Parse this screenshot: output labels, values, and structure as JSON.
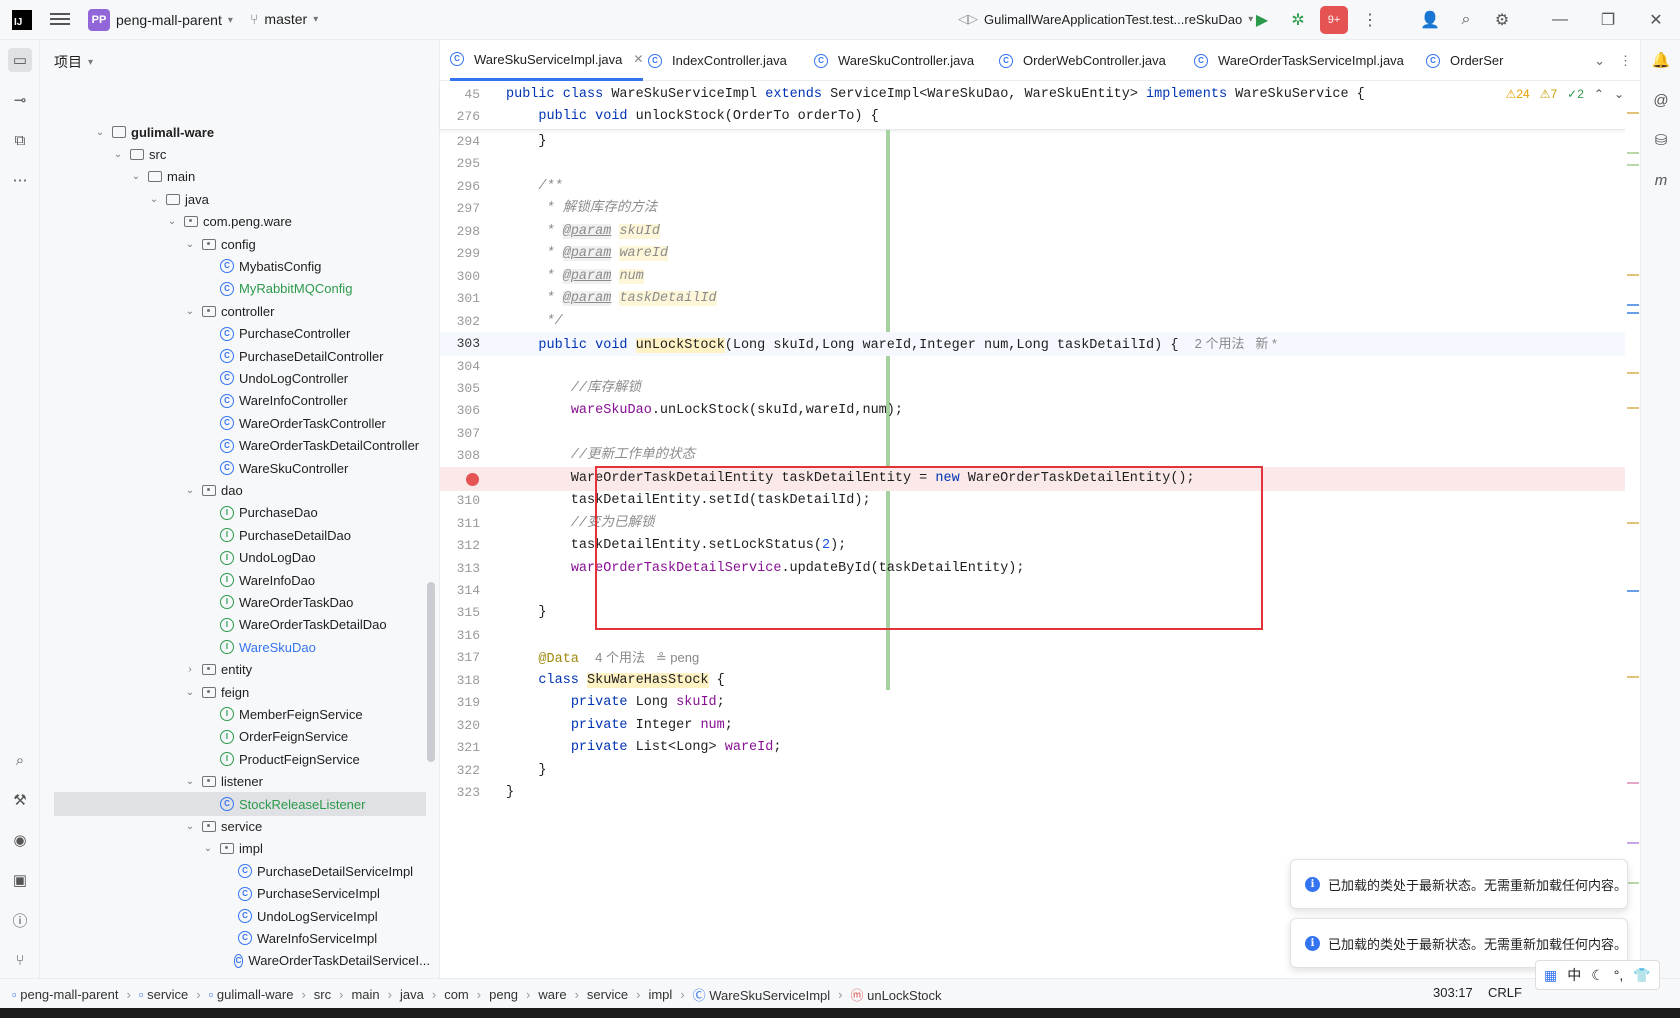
{
  "titlebar": {
    "project_badge": "PP",
    "project_name": "peng-mall-parent",
    "branch": "master",
    "run_config": "GulimallWareApplicationTest.test...reSkuDao",
    "record_badge": "9+"
  },
  "project_panel": {
    "title": "项目",
    "tree": [
      {
        "label": "gulimall-ware",
        "type": "module",
        "depth": 0,
        "arrow": "down",
        "bold": true
      },
      {
        "label": "src",
        "type": "folder",
        "depth": 1,
        "arrow": "down"
      },
      {
        "label": "main",
        "type": "folder",
        "depth": 2,
        "arrow": "down"
      },
      {
        "label": "java",
        "type": "folder",
        "depth": 3,
        "arrow": "down"
      },
      {
        "label": "com.peng.ware",
        "type": "package",
        "depth": 4,
        "arrow": "down"
      },
      {
        "label": "config",
        "type": "package",
        "depth": 5,
        "arrow": "down"
      },
      {
        "label": "MybatisConfig",
        "type": "class",
        "depth": 6
      },
      {
        "label": "MyRabbitMQConfig",
        "type": "class",
        "depth": 6,
        "color": "#2c9a4b"
      },
      {
        "label": "controller",
        "type": "package",
        "depth": 5,
        "arrow": "down"
      },
      {
        "label": "PurchaseController",
        "type": "class",
        "depth": 6
      },
      {
        "label": "PurchaseDetailController",
        "type": "class",
        "depth": 6
      },
      {
        "label": "UndoLogController",
        "type": "class",
        "depth": 6
      },
      {
        "label": "WareInfoController",
        "type": "class",
        "depth": 6
      },
      {
        "label": "WareOrderTaskController",
        "type": "class",
        "depth": 6
      },
      {
        "label": "WareOrderTaskDetailController",
        "type": "class",
        "depth": 6
      },
      {
        "label": "WareSkuController",
        "type": "class",
        "depth": 6
      },
      {
        "label": "dao",
        "type": "package",
        "depth": 5,
        "arrow": "down"
      },
      {
        "label": "PurchaseDao",
        "type": "interface",
        "depth": 6
      },
      {
        "label": "PurchaseDetailDao",
        "type": "interface",
        "depth": 6
      },
      {
        "label": "UndoLogDao",
        "type": "interface",
        "depth": 6
      },
      {
        "label": "WareInfoDao",
        "type": "interface",
        "depth": 6
      },
      {
        "label": "WareOrderTaskDao",
        "type": "interface",
        "depth": 6
      },
      {
        "label": "WareOrderTaskDetailDao",
        "type": "interface",
        "depth": 6
      },
      {
        "label": "WareSkuDao",
        "type": "interface",
        "depth": 6,
        "color": "#3574f0"
      },
      {
        "label": "entity",
        "type": "package",
        "depth": 5,
        "arrow": "right"
      },
      {
        "label": "feign",
        "type": "package",
        "depth": 5,
        "arrow": "down"
      },
      {
        "label": "MemberFeignService",
        "type": "interface",
        "depth": 6
      },
      {
        "label": "OrderFeignService",
        "type": "interface",
        "depth": 6
      },
      {
        "label": "ProductFeignService",
        "type": "interface",
        "depth": 6
      },
      {
        "label": "listener",
        "type": "package",
        "depth": 5,
        "arrow": "down"
      },
      {
        "label": "StockReleaseListener",
        "type": "class",
        "depth": 6,
        "color": "#2c9a4b",
        "selected": true
      },
      {
        "label": "service",
        "type": "package",
        "depth": 5,
        "arrow": "down"
      },
      {
        "label": "impl",
        "type": "package",
        "depth": 6,
        "arrow": "down"
      },
      {
        "label": "PurchaseDetailServiceImpl",
        "type": "class",
        "depth": 7
      },
      {
        "label": "PurchaseServiceImpl",
        "type": "class",
        "depth": 7
      },
      {
        "label": "UndoLogServiceImpl",
        "type": "class",
        "depth": 7
      },
      {
        "label": "WareInfoServiceImpl",
        "type": "class",
        "depth": 7
      },
      {
        "label": "WareOrderTaskDetailServiceI...",
        "type": "class",
        "depth": 7
      }
    ]
  },
  "editor_tabs": [
    {
      "label": "WareSkuServiceImpl.java",
      "active": true
    },
    {
      "label": "IndexController.java"
    },
    {
      "label": "WareSkuController.java"
    },
    {
      "label": "OrderWebController.java"
    },
    {
      "label": "WareOrderTaskServiceImpl.java"
    },
    {
      "label": "OrderSer"
    }
  ],
  "inspections": {
    "errors": "24",
    "warnings": "7",
    "ok": "2"
  },
  "sticky_lines": [
    {
      "ln": "45",
      "tokens": [
        [
          "kw",
          "public class "
        ],
        [
          "",
          "WareSkuServiceImpl "
        ],
        [
          "kw",
          "extends "
        ],
        [
          "",
          "ServiceImpl<WareSkuDao, WareSkuEntity> "
        ],
        [
          "kw",
          "implements "
        ],
        [
          "",
          "WareSkuService {"
        ]
      ]
    },
    {
      "ln": "276",
      "tokens": [
        [
          "",
          "    "
        ],
        [
          "kw",
          "public void "
        ],
        [
          "",
          "unlockStock(OrderTo orderTo) {"
        ]
      ]
    }
  ],
  "code_lines": [
    {
      "ln": "294",
      "tokens": [
        [
          "",
          "    }"
        ]
      ]
    },
    {
      "ln": "295",
      "tokens": []
    },
    {
      "ln": "296",
      "tokens": [
        [
          "cm",
          "    /**"
        ]
      ]
    },
    {
      "ln": "297",
      "tokens": [
        [
          "cm",
          "     * 解锁库存的方法"
        ]
      ]
    },
    {
      "ln": "298",
      "tokens": [
        [
          "cm",
          "     * "
        ],
        [
          "jd-tag",
          "@param"
        ],
        [
          "cm",
          " "
        ],
        [
          "jd-val",
          "skuId"
        ]
      ]
    },
    {
      "ln": "299",
      "tokens": [
        [
          "cm",
          "     * "
        ],
        [
          "jd-tag",
          "@param"
        ],
        [
          "cm",
          " "
        ],
        [
          "jd-val",
          "wareId"
        ]
      ]
    },
    {
      "ln": "300",
      "tokens": [
        [
          "cm",
          "     * "
        ],
        [
          "jd-tag",
          "@param"
        ],
        [
          "cm",
          " "
        ],
        [
          "jd-val",
          "num"
        ]
      ]
    },
    {
      "ln": "301",
      "tokens": [
        [
          "cm",
          "     * "
        ],
        [
          "jd-tag",
          "@param"
        ],
        [
          "cm",
          " "
        ],
        [
          "jd-val",
          "taskDetailId"
        ]
      ]
    },
    {
      "ln": "302",
      "tokens": [
        [
          "cm",
          "     */"
        ]
      ]
    },
    {
      "ln": "303",
      "current": true,
      "tokens": [
        [
          "",
          "    "
        ],
        [
          "kw",
          "public void "
        ],
        [
          "hl-word",
          "unLockStock"
        ],
        [
          "",
          "(Long skuId,Long wareId,Integer num,Long taskDetailId) {  "
        ],
        [
          "hint",
          "2 个用法   新 *"
        ]
      ]
    },
    {
      "ln": "304",
      "tokens": []
    },
    {
      "ln": "305",
      "tokens": [
        [
          "cm",
          "        //库存解锁"
        ]
      ]
    },
    {
      "ln": "306",
      "tokens": [
        [
          "",
          "        "
        ],
        [
          "fld",
          "wareSkuDao"
        ],
        [
          "",
          ".unLockStock(skuId,wareId,num);"
        ]
      ]
    },
    {
      "ln": "307",
      "tokens": []
    },
    {
      "ln": "308",
      "tokens": [
        [
          "cm",
          "        //更新工作单的状态"
        ]
      ]
    },
    {
      "ln": "309",
      "breakpoint": true,
      "tokens": [
        [
          "",
          "        WareOrderTaskDetailEntity taskDetailEntity = "
        ],
        [
          "kw",
          "new "
        ],
        [
          "",
          "WareOrderTaskDetailEntity();"
        ]
      ]
    },
    {
      "ln": "310",
      "tokens": [
        [
          "",
          "        taskDetailEntity.setId(taskDetailId);"
        ]
      ]
    },
    {
      "ln": "311",
      "tokens": [
        [
          "cm",
          "        //变为已解锁"
        ]
      ]
    },
    {
      "ln": "312",
      "tokens": [
        [
          "",
          "        taskDetailEntity.setLockStatus("
        ],
        [
          "num",
          "2"
        ],
        [
          "",
          ");"
        ]
      ]
    },
    {
      "ln": "313",
      "tokens": [
        [
          "",
          "        "
        ],
        [
          "fld",
          "wareOrderTaskDetailService"
        ],
        [
          "",
          ".updateById(taskDetailEntity);"
        ]
      ]
    },
    {
      "ln": "314",
      "tokens": []
    },
    {
      "ln": "315",
      "tokens": [
        [
          "",
          "    }"
        ]
      ]
    },
    {
      "ln": "316",
      "tokens": []
    },
    {
      "ln": "317",
      "tokens": [
        [
          "",
          "    "
        ],
        [
          "an",
          "@Data"
        ],
        [
          "",
          "  "
        ],
        [
          "hint",
          "4 个用法   ≗ peng"
        ]
      ]
    },
    {
      "ln": "318",
      "tokens": [
        [
          "",
          "    "
        ],
        [
          "kw",
          "class "
        ],
        [
          "hl-word",
          "SkuWareHasStock"
        ],
        [
          "",
          " {"
        ]
      ]
    },
    {
      "ln": "319",
      "tokens": [
        [
          "",
          "        "
        ],
        [
          "kw",
          "private "
        ],
        [
          "",
          "Long "
        ],
        [
          "fld",
          "skuId"
        ],
        [
          "",
          ";"
        ]
      ]
    },
    {
      "ln": "320",
      "tokens": [
        [
          "",
          "        "
        ],
        [
          "kw",
          "private "
        ],
        [
          "",
          "Integer "
        ],
        [
          "fld",
          "num"
        ],
        [
          "",
          ";"
        ]
      ]
    },
    {
      "ln": "321",
      "tokens": [
        [
          "",
          "        "
        ],
        [
          "kw",
          "private "
        ],
        [
          "",
          "List<Long> "
        ],
        [
          "fld",
          "wareId"
        ],
        [
          "",
          ";"
        ]
      ]
    },
    {
      "ln": "322",
      "tokens": [
        [
          "",
          "    }"
        ]
      ]
    },
    {
      "ln": "323",
      "tokens": [
        [
          "",
          "}"
        ]
      ]
    }
  ],
  "notifications": [
    "已加载的类处于最新状态。无需重新加载任何内容。",
    "已加载的类处于最新状态。无需重新加载任何内容。"
  ],
  "breadcrumbs": [
    {
      "label": "peng-mall-parent",
      "icon": "module"
    },
    {
      "label": "service",
      "icon": "folder"
    },
    {
      "label": "gulimall-ware",
      "icon": "module"
    },
    {
      "label": "src"
    },
    {
      "label": "main"
    },
    {
      "label": "java"
    },
    {
      "label": "com"
    },
    {
      "label": "peng"
    },
    {
      "label": "ware"
    },
    {
      "label": "service"
    },
    {
      "label": "impl"
    },
    {
      "label": "WareSkuServiceImpl",
      "icon": "class"
    },
    {
      "label": "unLockStock",
      "icon": "method"
    }
  ],
  "status": {
    "position": "303:17",
    "line_ending": "CRLF"
  },
  "ime": {
    "lang": "中"
  }
}
